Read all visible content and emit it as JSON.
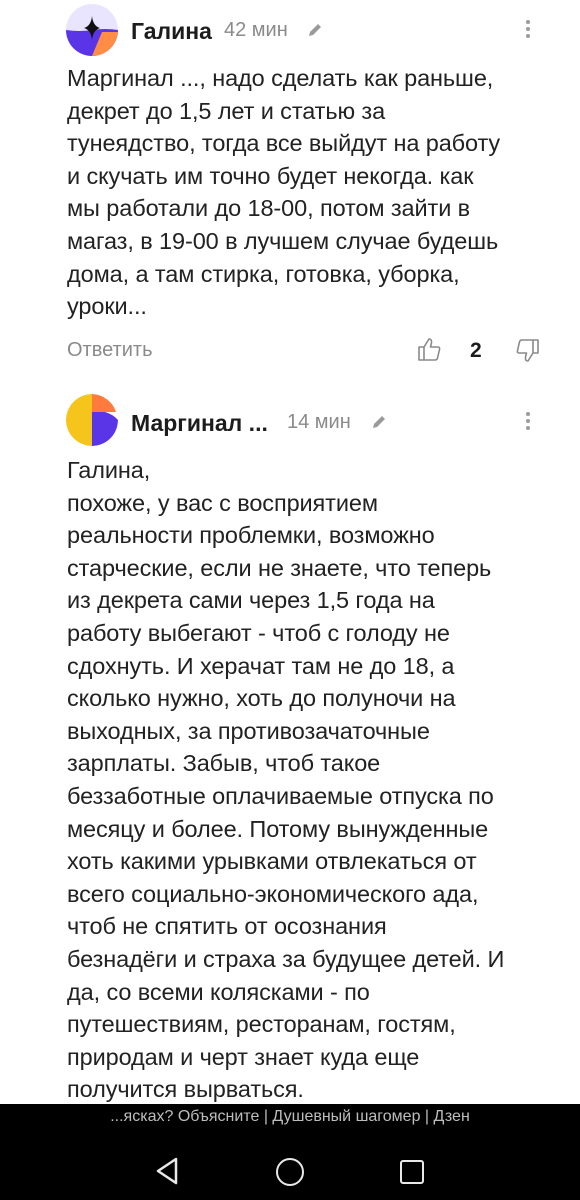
{
  "comments": [
    {
      "author": "Галина",
      "time": "42 мин",
      "avatar_colors": [
        "#5a35e8",
        "#e9e4ff",
        "#ff8d45"
      ],
      "text_lines": [
        "Маргинал ..., надо сделать как раньше,",
        "декрет до 1,5 лет и статью за",
        "тунеядство, тогда все выйдут на работу",
        "и скучать им точно будет некогда. как",
        "мы работали до 18-00, потом зайти в",
        "магаз, в 19-00 в лучшем случае будешь",
        "дома, а там стирка, готовка, уборка,",
        "уроки..."
      ],
      "reply_label": "Ответить",
      "like_count": "2"
    },
    {
      "author": "Маргинал ...",
      "time": "14 мин",
      "avatar_colors": [
        "#f5c51b",
        "#5a35e8",
        "#ff7a3d",
        "#ffffff"
      ],
      "text_lines": [
        "Галина,",
        "похоже, у вас с восприятием",
        "реальности проблемки, возможно",
        "старческие, если не знаете, что теперь",
        "из декрета сами через 1,5 года на",
        "работу выбегают - чтоб с голоду не",
        "сдохнуть. И херачат там не до 18, а",
        "сколько нужно, хоть до полуночи на",
        "выходных, за противозачаточные",
        "зарплаты. Забыв, чтоб такое",
        "беззаботные оплачиваемые отпуска по",
        "месяцу и более. Потому вынужденные",
        "хоть какими урывками отвлекаться от",
        "всего социально-экономического ада,",
        "чтоб не спятить от осознания",
        "безнадёги и страха за будущее детей. И",
        "да, со всеми колясками - по",
        "путешествиям, ресторанам, гостям,",
        "природам и черт знает куда еще",
        "получится вырваться."
      ]
    }
  ],
  "bottom_bar": {
    "page_title": "...ясках? Объясните | Душевный шагомер | Дзен",
    "nav_icons": [
      "back-triangle-icon",
      "home-circle-icon",
      "recent-apps-square-icon"
    ]
  }
}
